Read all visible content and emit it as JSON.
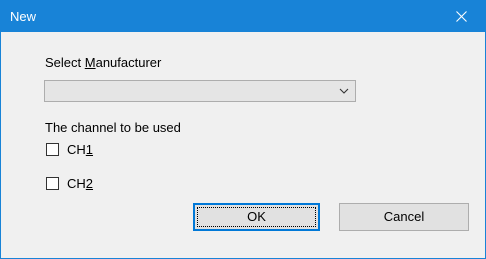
{
  "window": {
    "title": "New",
    "close_icon": "close-icon"
  },
  "manufacturer": {
    "label_prefix": "Select ",
    "label_accel": "M",
    "label_suffix": "anufacturer",
    "selected_value": "",
    "arrow_icon": "chevron-down-icon"
  },
  "channel": {
    "label": "The channel to be used",
    "options": [
      {
        "label_prefix": "CH",
        "label_accel": "1",
        "checked": false
      },
      {
        "label_prefix": "CH",
        "label_accel": "2",
        "checked": false
      }
    ]
  },
  "buttons": {
    "ok_label": "OK",
    "cancel_label": "Cancel"
  },
  "colors": {
    "titlebar": "#1883d7",
    "dialog_bg": "#f0f0f0",
    "button_bg": "#e1e1e1",
    "focus_border": "#0078d7"
  }
}
